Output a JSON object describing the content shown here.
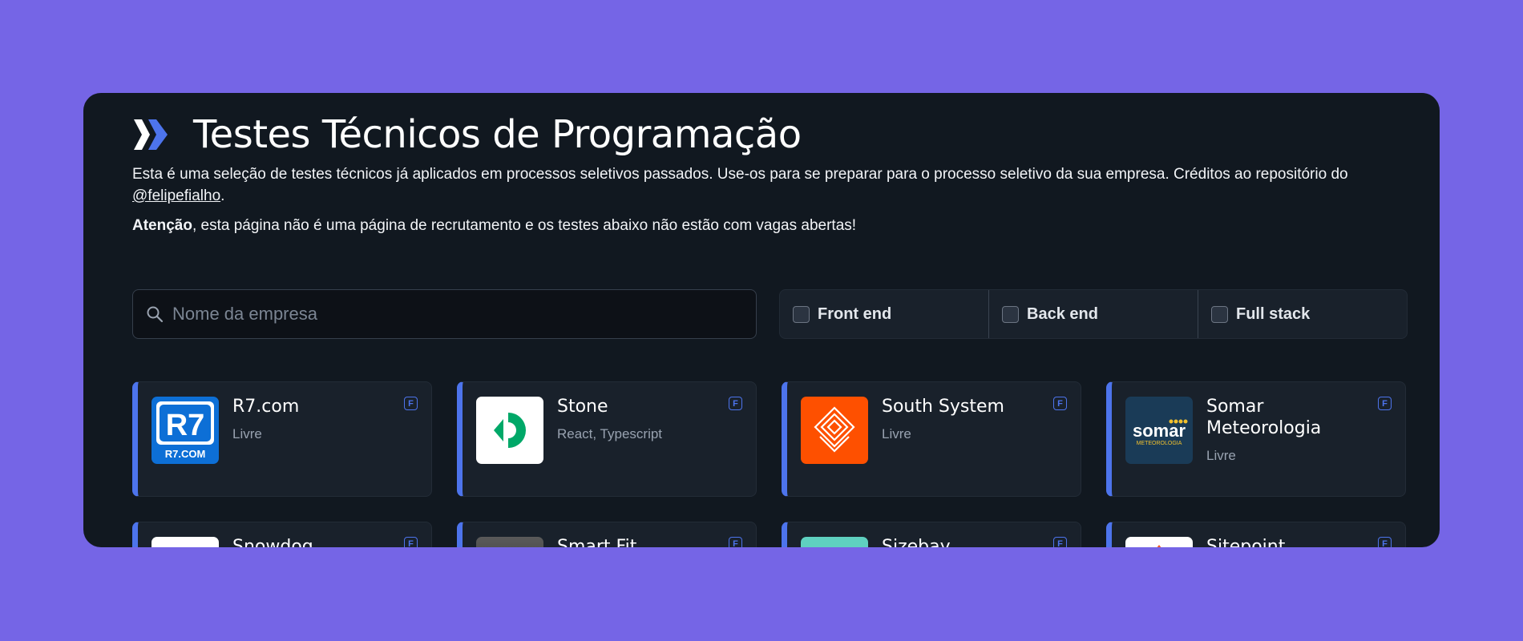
{
  "header": {
    "title": "Testes Técnicos de Programação",
    "description": "Esta é uma seleção de testes técnicos já aplicados em processos seletivos passados. Use-os para se preparar para o processo seletivo da sua empresa. Créditos ao repositório do ",
    "credit_link": "@felipefialho",
    "description_end": ".",
    "warning_bold": "Atenção",
    "warning_text": ", esta página não é uma página de recrutamento e os testes abaixo não estão com vagas abertas!"
  },
  "search": {
    "placeholder": "Nome da empresa",
    "value": ""
  },
  "filters": [
    {
      "label": "Front end",
      "checked": false
    },
    {
      "label": "Back end",
      "checked": false
    },
    {
      "label": "Full stack",
      "checked": false
    }
  ],
  "cards": [
    {
      "name": "R7.com",
      "tags": "Livre",
      "badge": "F",
      "logo": "r7-logo"
    },
    {
      "name": "Stone",
      "tags": "React, Typescript",
      "badge": "F",
      "logo": "stone-logo"
    },
    {
      "name": "South System",
      "tags": "Livre",
      "badge": "F",
      "logo": "south-system-logo"
    },
    {
      "name": "Somar Meteorologia",
      "tags": "Livre",
      "badge": "F",
      "logo": "somar-logo"
    },
    {
      "name": "Snowdog",
      "tags": "",
      "badge": "F",
      "logo": "snowdog-logo"
    },
    {
      "name": "Smart Fit",
      "tags": "",
      "badge": "F",
      "logo": "smart-fit-logo"
    },
    {
      "name": "Sizebay",
      "tags": "",
      "badge": "F",
      "logo": "sizebay-logo"
    },
    {
      "name": "Sitepoint",
      "tags": "",
      "badge": "F",
      "logo": "sitepoint-logo"
    }
  ],
  "logo_texts": {
    "r7_main": "R7",
    "r7_sub": "R7.COM",
    "somar_main": "somar",
    "somar_sub": "METEOROLOGIA"
  },
  "colors": {
    "background": "#7565e6",
    "panel": "#111820",
    "card": "#19212b",
    "accent": "#4d74ec"
  }
}
